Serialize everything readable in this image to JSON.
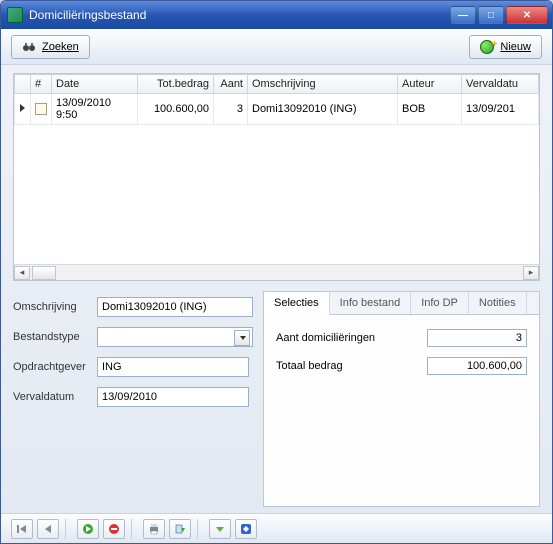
{
  "window": {
    "title": "Domiciliëringsbestand"
  },
  "toolbar": {
    "search_label": "Zoeken",
    "new_label": "Nieuw"
  },
  "grid": {
    "columns": {
      "num": "#",
      "date": "Date",
      "tot_bedrag": "Tot.bedrag",
      "aant": "Aant",
      "omschrijving": "Omschrijving",
      "auteur": "Auteur",
      "vervaldatum": "Vervaldatu"
    },
    "rows": [
      {
        "date": "13/09/2010 9:50",
        "tot_bedrag": "100.600,00",
        "aant": "3",
        "omschrijving": "Domi13092010 (ING)",
        "auteur": "BOB",
        "vervaldatum": "13/09/201"
      }
    ]
  },
  "form": {
    "labels": {
      "omschrijving": "Omschrijving",
      "bestandstype": "Bestandstype",
      "opdrachtgever": "Opdrachtgever",
      "vervaldatum": "Vervaldatum"
    },
    "values": {
      "omschrijving": "Domi13092010 (ING)",
      "bestandstype": "",
      "opdrachtgever": "ING",
      "vervaldatum": "13/09/2010"
    }
  },
  "tabs": {
    "selecties": "Selecties",
    "info_bestand": "Info bestand",
    "info_dp": "Info DP",
    "notities": "Notities"
  },
  "selecties_panel": {
    "aant_label": "Aant domiciliëringen",
    "aant_value": "3",
    "totaal_label": "Totaal bedrag",
    "totaal_value": "100.600,00"
  },
  "bottom_icons": {
    "i1": "nav-first",
    "i2": "nav-prev",
    "i3": "go",
    "i4": "stop",
    "i5": "print",
    "i6": "export",
    "i7": "down",
    "i8": "tag"
  }
}
